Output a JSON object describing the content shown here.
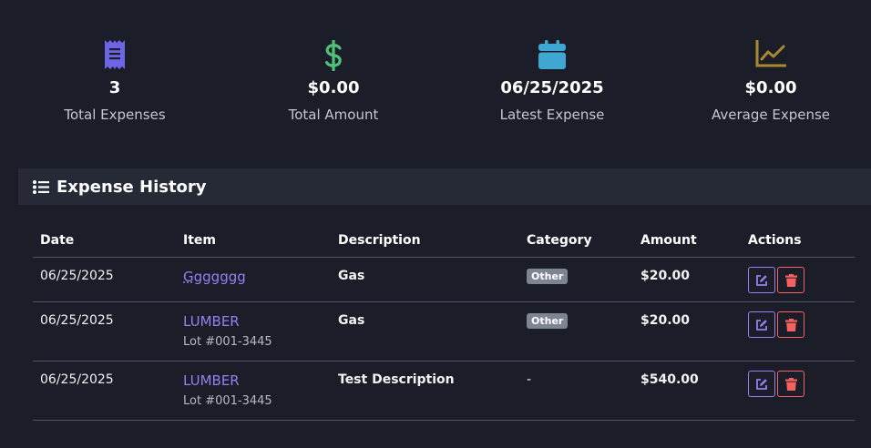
{
  "stats": [
    {
      "icon": "receipt-icon",
      "value": "3",
      "label": "Total Expenses",
      "color": "#6f63e6"
    },
    {
      "icon": "dollar-icon",
      "value": "$0.00",
      "label": "Total Amount",
      "color": "#4fc27a"
    },
    {
      "icon": "calendar-icon",
      "value": "06/25/2025",
      "label": "Latest Expense",
      "color": "#3ea8d2"
    },
    {
      "icon": "line-chart-icon",
      "value": "$0.00",
      "label": "Average Expense",
      "color": "#a98a2e"
    }
  ],
  "section": {
    "title": "Expense History",
    "icon": "list-icon"
  },
  "table": {
    "headers": [
      "Date",
      "Item",
      "Description",
      "Category",
      "Amount",
      "Actions"
    ],
    "rows": [
      {
        "date": "06/25/2025",
        "item": "Ggggggg",
        "lot": "",
        "description": "Gas",
        "category": "Other",
        "amount": "$20.00"
      },
      {
        "date": "06/25/2025",
        "item": "LUMBER",
        "lot": "Lot #001-3445",
        "description": "Gas",
        "category": "Other",
        "amount": "$20.00"
      },
      {
        "date": "06/25/2025",
        "item": "LUMBER",
        "lot": "Lot #001-3445",
        "description": "Test Description",
        "category": "-",
        "amount": "$540.00"
      }
    ]
  },
  "colors": {
    "accent": "#8f83f0",
    "danger": "#f4615f",
    "badge": "#7d8593"
  }
}
